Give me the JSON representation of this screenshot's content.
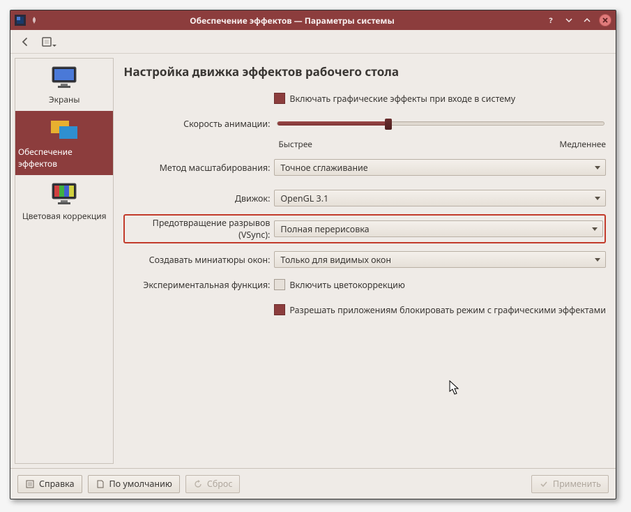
{
  "titlebar": {
    "title": "Обеспечение эффектов  —  Параметры системы"
  },
  "sidebar": {
    "items": [
      {
        "label": "Экраны"
      },
      {
        "label": "Обеспечение эффектов"
      },
      {
        "label": "Цветовая коррекция"
      }
    ]
  },
  "main": {
    "page_title": "Настройка движка эффектов рабочего стола",
    "enable_on_login_label": "Включать графические эффекты при входе в систему",
    "anim_speed_label": "Скорость анимации:",
    "anim_speed_min": "Быстрее",
    "anim_speed_max": "Медленнее",
    "scaling_label": "Метод масштабирования:",
    "scaling_value": "Точное сглаживание",
    "engine_label": "Движок:",
    "engine_value": "OpenGL 3.1",
    "vsync_label": "Предотвращение разрывов (VSync):",
    "vsync_value": "Полная перерисовка",
    "thumbs_label": "Создавать миниатюры окон:",
    "thumbs_value": "Только для видимых окон",
    "exp_label": "Экспериментальная функция:",
    "exp_check1": "Включить цветокоррекцию",
    "exp_check2": "Разрешать приложениям блокировать режим с графическими эффектами"
  },
  "footer": {
    "help": "Справка",
    "defaults": "По умолчанию",
    "reset": "Сброс",
    "apply": "Применить"
  }
}
